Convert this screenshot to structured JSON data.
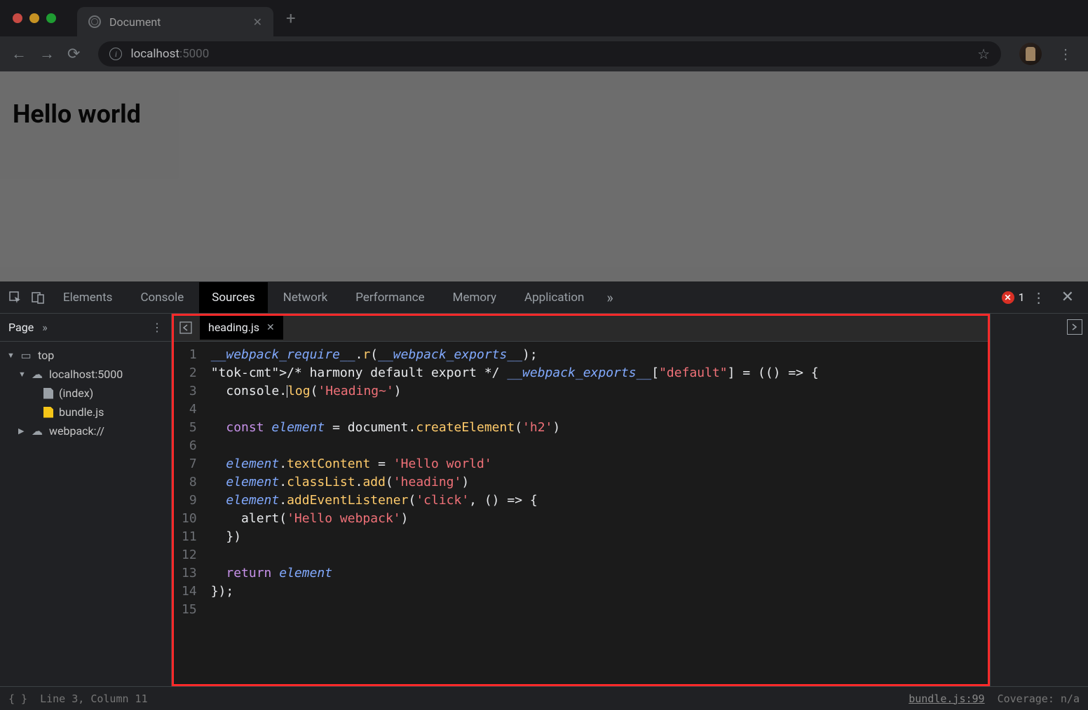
{
  "browser": {
    "tab_title": "Document",
    "url_host": "localhost",
    "url_port": ":5000"
  },
  "page": {
    "heading": "Hello world"
  },
  "devtools": {
    "tabs": [
      "Elements",
      "Console",
      "Sources",
      "Network",
      "Performance",
      "Memory",
      "Application"
    ],
    "active_tab": "Sources",
    "error_count": "1",
    "sidebar": {
      "label": "Page",
      "tree": {
        "top": "top",
        "host": "localhost:5000",
        "index": "(index)",
        "bundle": "bundle.js",
        "webpack": "webpack://"
      }
    },
    "editor": {
      "tab": "heading.js",
      "lines": [
        "__webpack_require__.r(__webpack_exports__);",
        "/* harmony default export */ __webpack_exports__[\"default\"] = (() => {",
        "  console.log('Heading~')",
        "",
        "  const element = document.createElement('h2')",
        "",
        "  element.textContent = 'Hello world'",
        "  element.classList.add('heading')",
        "  element.addEventListener('click', () => {",
        "    alert('Hello webpack')",
        "  })",
        "",
        "  return element",
        "});",
        ""
      ]
    },
    "status": {
      "position": "Line 3, Column 11",
      "source_link": "bundle.js:99",
      "coverage": "Coverage: n/a"
    }
  }
}
